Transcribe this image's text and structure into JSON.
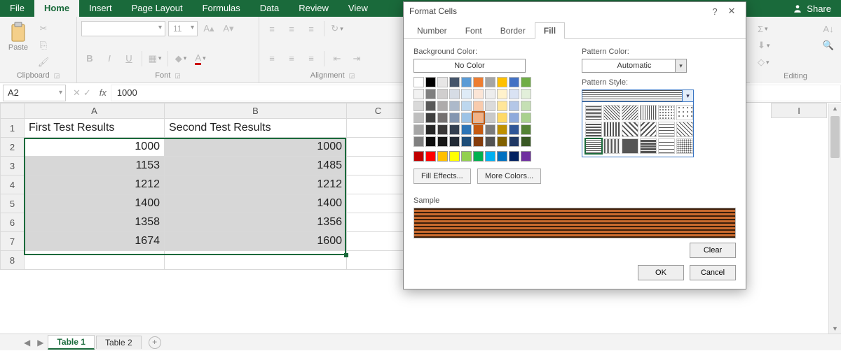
{
  "ribbon": {
    "tabs": [
      "File",
      "Home",
      "Insert",
      "Page Layout",
      "Formulas",
      "Data",
      "Review",
      "View"
    ],
    "active_tab": "Home",
    "share": "Share"
  },
  "groups": {
    "clipboard": {
      "title": "Clipboard",
      "paste": "Paste"
    },
    "font": {
      "title": "Font",
      "size": "11"
    },
    "alignment": {
      "title": "Alignment"
    },
    "editing": {
      "title": "Editing"
    }
  },
  "namebox": "A2",
  "formula": "1000",
  "columns": [
    "",
    "A",
    "B",
    "C"
  ],
  "extra_col": "I",
  "rows": [
    {
      "n": "1",
      "a": "First Test Results",
      "b": "Second Test Results"
    },
    {
      "n": "2",
      "a": "1000",
      "b": "1000"
    },
    {
      "n": "3",
      "a": "1153",
      "b": "1485"
    },
    {
      "n": "4",
      "a": "1212",
      "b": "1212"
    },
    {
      "n": "5",
      "a": "1400",
      "b": "1400"
    },
    {
      "n": "6",
      "a": "1358",
      "b": "1356"
    },
    {
      "n": "7",
      "a": "1674",
      "b": "1600"
    },
    {
      "n": "8",
      "a": "",
      "b": ""
    }
  ],
  "sheets": {
    "tabs": [
      "Table 1",
      "Table 2"
    ],
    "active": "Table 1"
  },
  "dialog": {
    "title": "Format Cells",
    "tabs": [
      "Number",
      "Font",
      "Border",
      "Fill"
    ],
    "active_tab": "Fill",
    "bg_label": "Background Color:",
    "no_color": "No Color",
    "fill_effects": "Fill Effects...",
    "more_colors": "More Colors...",
    "pat_color_label": "Pattern Color:",
    "pat_color_value": "Automatic",
    "pat_style_label": "Pattern Style:",
    "sample_label": "Sample",
    "clear": "Clear",
    "ok": "OK",
    "cancel": "Cancel",
    "theme_colors": [
      "#ffffff",
      "#000000",
      "#e7e6e6",
      "#44546a",
      "#5b9bd5",
      "#ed7d31",
      "#a5a5a5",
      "#ffc000",
      "#4472c4",
      "#70ad47",
      "#f2f2f2",
      "#7f7f7f",
      "#d0cece",
      "#d6dce5",
      "#deebf7",
      "#fbe5d6",
      "#ededed",
      "#fff2cc",
      "#d9e2f3",
      "#e2efda",
      "#d9d9d9",
      "#595959",
      "#aeabab",
      "#adb9ca",
      "#bdd7ee",
      "#f8cbad",
      "#dbdbdb",
      "#ffe699",
      "#b4c7e7",
      "#c5e0b4",
      "#bfbfbf",
      "#3f3f3f",
      "#757171",
      "#8496b0",
      "#9dc3e6",
      "#f4b183",
      "#c9c9c9",
      "#ffd966",
      "#8faadc",
      "#a9d18e",
      "#a6a6a6",
      "#262626",
      "#3a3838",
      "#333f50",
      "#2e75b6",
      "#c55a11",
      "#7b7b7b",
      "#bf9000",
      "#2f5597",
      "#548235",
      "#808080",
      "#0d0d0d",
      "#171717",
      "#222a35",
      "#1f4e79",
      "#843c0c",
      "#525252",
      "#806000",
      "#203864",
      "#385724"
    ],
    "standard_colors": [
      "#c00000",
      "#ff0000",
      "#ffc000",
      "#ffff00",
      "#92d050",
      "#00b050",
      "#00b0f0",
      "#0070c0",
      "#002060",
      "#7030a0"
    ],
    "selected_theme_idx": 35
  }
}
